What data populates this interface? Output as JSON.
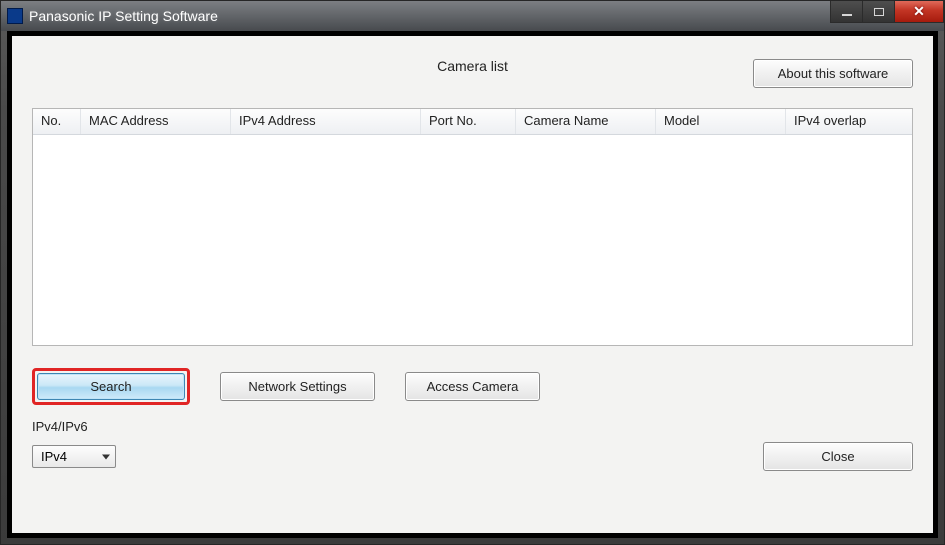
{
  "window": {
    "title": "Panasonic IP Setting Software"
  },
  "header": {
    "camera_list_label": "Camera list",
    "about_button": "About this software"
  },
  "table": {
    "columns": {
      "no": "No.",
      "mac": "MAC Address",
      "ipv4": "IPv4 Address",
      "port": "Port No.",
      "camera_name": "Camera Name",
      "model": "Model",
      "ipv4_overlap": "IPv4 overlap"
    },
    "rows": []
  },
  "actions": {
    "search": "Search",
    "network_settings": "Network Settings",
    "access_camera": "Access Camera"
  },
  "ip_section": {
    "label": "IPv4/IPv6",
    "selected": "IPv4"
  },
  "footer": {
    "close": "Close"
  }
}
